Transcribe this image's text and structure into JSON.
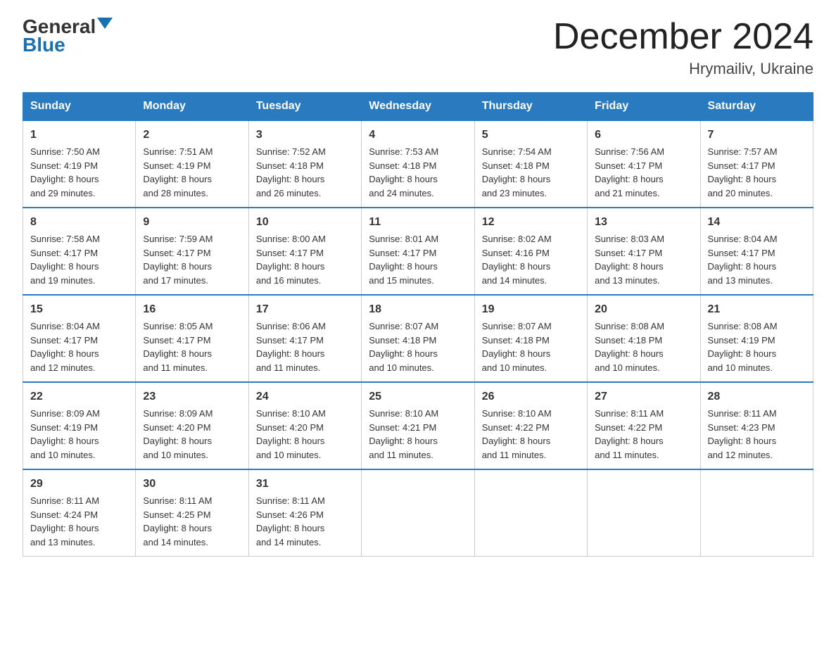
{
  "header": {
    "logo_general": "General",
    "logo_blue": "Blue",
    "title": "December 2024",
    "subtitle": "Hrymailiv, Ukraine"
  },
  "days_of_week": [
    "Sunday",
    "Monday",
    "Tuesday",
    "Wednesday",
    "Thursday",
    "Friday",
    "Saturday"
  ],
  "weeks": [
    [
      {
        "day": "1",
        "sunrise": "7:50 AM",
        "sunset": "4:19 PM",
        "daylight": "8 hours and 29 minutes."
      },
      {
        "day": "2",
        "sunrise": "7:51 AM",
        "sunset": "4:19 PM",
        "daylight": "8 hours and 28 minutes."
      },
      {
        "day": "3",
        "sunrise": "7:52 AM",
        "sunset": "4:18 PM",
        "daylight": "8 hours and 26 minutes."
      },
      {
        "day": "4",
        "sunrise": "7:53 AM",
        "sunset": "4:18 PM",
        "daylight": "8 hours and 24 minutes."
      },
      {
        "day": "5",
        "sunrise": "7:54 AM",
        "sunset": "4:18 PM",
        "daylight": "8 hours and 23 minutes."
      },
      {
        "day": "6",
        "sunrise": "7:56 AM",
        "sunset": "4:17 PM",
        "daylight": "8 hours and 21 minutes."
      },
      {
        "day": "7",
        "sunrise": "7:57 AM",
        "sunset": "4:17 PM",
        "daylight": "8 hours and 20 minutes."
      }
    ],
    [
      {
        "day": "8",
        "sunrise": "7:58 AM",
        "sunset": "4:17 PM",
        "daylight": "8 hours and 19 minutes."
      },
      {
        "day": "9",
        "sunrise": "7:59 AM",
        "sunset": "4:17 PM",
        "daylight": "8 hours and 17 minutes."
      },
      {
        "day": "10",
        "sunrise": "8:00 AM",
        "sunset": "4:17 PM",
        "daylight": "8 hours and 16 minutes."
      },
      {
        "day": "11",
        "sunrise": "8:01 AM",
        "sunset": "4:17 PM",
        "daylight": "8 hours and 15 minutes."
      },
      {
        "day": "12",
        "sunrise": "8:02 AM",
        "sunset": "4:16 PM",
        "daylight": "8 hours and 14 minutes."
      },
      {
        "day": "13",
        "sunrise": "8:03 AM",
        "sunset": "4:17 PM",
        "daylight": "8 hours and 13 minutes."
      },
      {
        "day": "14",
        "sunrise": "8:04 AM",
        "sunset": "4:17 PM",
        "daylight": "8 hours and 13 minutes."
      }
    ],
    [
      {
        "day": "15",
        "sunrise": "8:04 AM",
        "sunset": "4:17 PM",
        "daylight": "8 hours and 12 minutes."
      },
      {
        "day": "16",
        "sunrise": "8:05 AM",
        "sunset": "4:17 PM",
        "daylight": "8 hours and 11 minutes."
      },
      {
        "day": "17",
        "sunrise": "8:06 AM",
        "sunset": "4:17 PM",
        "daylight": "8 hours and 11 minutes."
      },
      {
        "day": "18",
        "sunrise": "8:07 AM",
        "sunset": "4:18 PM",
        "daylight": "8 hours and 10 minutes."
      },
      {
        "day": "19",
        "sunrise": "8:07 AM",
        "sunset": "4:18 PM",
        "daylight": "8 hours and 10 minutes."
      },
      {
        "day": "20",
        "sunrise": "8:08 AM",
        "sunset": "4:18 PM",
        "daylight": "8 hours and 10 minutes."
      },
      {
        "day": "21",
        "sunrise": "8:08 AM",
        "sunset": "4:19 PM",
        "daylight": "8 hours and 10 minutes."
      }
    ],
    [
      {
        "day": "22",
        "sunrise": "8:09 AM",
        "sunset": "4:19 PM",
        "daylight": "8 hours and 10 minutes."
      },
      {
        "day": "23",
        "sunrise": "8:09 AM",
        "sunset": "4:20 PM",
        "daylight": "8 hours and 10 minutes."
      },
      {
        "day": "24",
        "sunrise": "8:10 AM",
        "sunset": "4:20 PM",
        "daylight": "8 hours and 10 minutes."
      },
      {
        "day": "25",
        "sunrise": "8:10 AM",
        "sunset": "4:21 PM",
        "daylight": "8 hours and 11 minutes."
      },
      {
        "day": "26",
        "sunrise": "8:10 AM",
        "sunset": "4:22 PM",
        "daylight": "8 hours and 11 minutes."
      },
      {
        "day": "27",
        "sunrise": "8:11 AM",
        "sunset": "4:22 PM",
        "daylight": "8 hours and 11 minutes."
      },
      {
        "day": "28",
        "sunrise": "8:11 AM",
        "sunset": "4:23 PM",
        "daylight": "8 hours and 12 minutes."
      }
    ],
    [
      {
        "day": "29",
        "sunrise": "8:11 AM",
        "sunset": "4:24 PM",
        "daylight": "8 hours and 13 minutes."
      },
      {
        "day": "30",
        "sunrise": "8:11 AM",
        "sunset": "4:25 PM",
        "daylight": "8 hours and 14 minutes."
      },
      {
        "day": "31",
        "sunrise": "8:11 AM",
        "sunset": "4:26 PM",
        "daylight": "8 hours and 14 minutes."
      },
      null,
      null,
      null,
      null
    ]
  ],
  "labels": {
    "sunrise_prefix": "Sunrise: ",
    "sunset_prefix": "Sunset: ",
    "daylight_prefix": "Daylight: "
  }
}
